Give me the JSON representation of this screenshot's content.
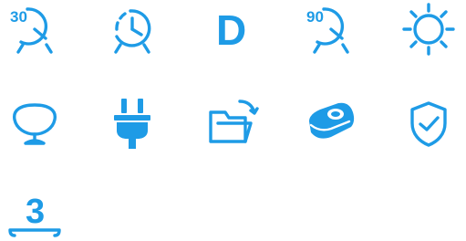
{
  "icons": [
    {
      "name": "timer-30-icon",
      "text": "30"
    },
    {
      "name": "timer-dashed-icon"
    },
    {
      "name": "letter-d-icon",
      "text": "D"
    },
    {
      "name": "timer-90-icon",
      "text": "90"
    },
    {
      "name": "sun-icon"
    },
    {
      "name": "glass-icon"
    },
    {
      "name": "plug-icon"
    },
    {
      "name": "folder-open-icon"
    },
    {
      "name": "soap-icon"
    },
    {
      "name": "shield-check-icon"
    },
    {
      "name": "number-3-icon",
      "text": "3"
    }
  ],
  "colors": {
    "accent": "#1e9be6"
  }
}
